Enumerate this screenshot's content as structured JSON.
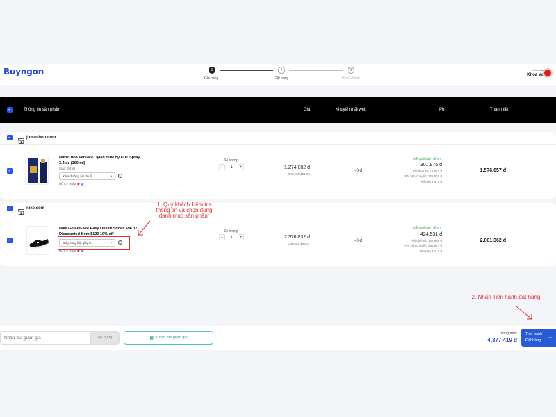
{
  "brand": {
    "logo_text": "Buyngon"
  },
  "steps": [
    {
      "num": "1",
      "label": "Giỏ hàng"
    },
    {
      "num": "2",
      "label": "Đặt hàng"
    },
    {
      "num": "3",
      "label": "Hoàn thành"
    }
  ],
  "user": {
    "greeting": "Xin chào",
    "name": "Khoa Vo"
  },
  "table_header": {
    "product_info": "Thông tin sản phẩm",
    "price": "Giá",
    "promo": "Khuyến mãi web",
    "fee": "Phí",
    "total": "Thành tiền"
  },
  "shops": [
    {
      "name": "jomashop.com",
      "product": {
        "name_line1": "Nước Hoa Versace Dylan Blue by EDT Spray",
        "name_line2": "3.4 oz (100 ml)",
        "size": "Size: 3.4 oz",
        "category": "Xem dưỡng ẩm, Nuôi...",
        "support": "Hỗ trợ nhập:",
        "qty_label": "Số lượng",
        "qty": "1",
        "price": "1.274,082 đ",
        "price_usd": "Giá usd: $51.99",
        "promo": "~0 đ",
        "fee_badge": "Miễn phí bảo hiểm",
        "fee_total": "301.975 đ",
        "fee_service": "Phí dịch vụ: 76.474 đ",
        "fee_shipping": "Phí vận chuyển: 225.501 đ",
        "fee_extra": "Phí phụ thu: 0 đ",
        "line_total": "1.576.057 đ"
      }
    },
    {
      "name": "nike.com",
      "product": {
        "name_line1": "Nike Go FlyEase Easy On/Off Shoes $96.37",
        "name_line2": "Discounted from $120 19% off",
        "category": "Giày chạy bộ, giày tr...",
        "support": "Hỗ trợ nhập:",
        "qty_label": "Số lượng",
        "qty": "1",
        "price": "2.376,832 đ",
        "price_usd": "Giá usd: $96.37",
        "promo": "~0 đ",
        "fee_badge": "Miễn phí bảo hiểm",
        "fee_total": "424.531 đ",
        "fee_service": "Phí dịch vụ: 142.654 đ",
        "fee_shipping": "Phí vận chuyển: 281.877 đ",
        "fee_extra": "Phí phụ thu: 0 đ",
        "line_total": "2.801.362 đ"
      }
    }
  ],
  "annotations": {
    "note1_line1": "1. Quý khách kiểm tra",
    "note1_line2": "thông tin và chọn đúng",
    "note1_line3": "danh mục sản phẩm",
    "note2": "2. Nhấn Tiến hành đặt hàng"
  },
  "footer": {
    "voucher_placeholder": "Nhập mã giảm giá",
    "apply_label": "Áp dụng",
    "voucher_button": "Chọn thẻ giảm giá",
    "total_label": "Tổng tiền:",
    "total_value": "4,377,419 đ",
    "checkout_line1": "Tiến hành",
    "checkout_line2": "Đặt hàng"
  },
  "colors": {
    "accent": "#2a5bd7",
    "annotation": "#e03131",
    "free_badge": "#3aa84b"
  }
}
